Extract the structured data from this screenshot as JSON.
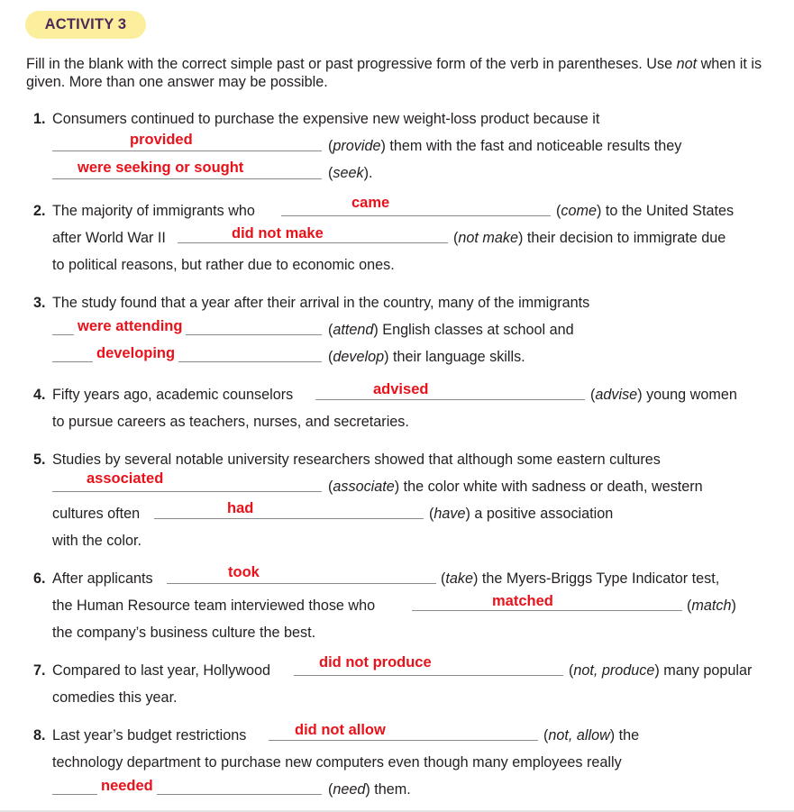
{
  "header": {
    "badge": "ACTIVITY 3"
  },
  "instructions": {
    "part1": "Fill in the blank with the correct simple past or past progressive form of the verb in parentheses. Use ",
    "not_word": "not",
    "part2": " when it is given. More than one answer may be possible."
  },
  "items": {
    "i1": {
      "num": "1.",
      "t1": "Consumers continued to purchase the expensive new weight-loss product because it",
      "v1": "provide",
      "t2": " them with the fast and noticeable results they",
      "v2": "seek",
      "t3": ".",
      "a1": "provided",
      "a2": "were seeking or sought"
    },
    "i2": {
      "num": "2.",
      "t1": "The majority of immigrants who",
      "v1": "come",
      "t2": " to the United States",
      "t3": "after World War II",
      "v2": "not make",
      "t4": " their decision to immigrate due",
      "t5": "to political reasons, but rather due to economic ones.",
      "a1": "came",
      "a2": "did not make"
    },
    "i3": {
      "num": "3.",
      "t1": "The study found that a year after their arrival in the country, many of the immigrants",
      "v1": "attend",
      "t2": " English classes at school and",
      "v2": "develop",
      "t3": " their language skills.",
      "a1": "were attending",
      "a2": "developing"
    },
    "i4": {
      "num": "4.",
      "t1": "Fifty years ago, academic counselors",
      "v1": "advise",
      "t2": " young women",
      "t3": "to pursue careers as teachers, nurses, and secretaries.",
      "a1": "advised"
    },
    "i5": {
      "num": "5.",
      "t1": "Studies by several notable university researchers showed that although some eastern cultures",
      "v1": "associate",
      "t2": " the color white with sadness or death, western",
      "t3": "cultures often",
      "v2": "have",
      "t4": " a positive association",
      "t5": "with the color.",
      "a1": "associated",
      "a2": "had"
    },
    "i6": {
      "num": "6.",
      "t1": "After applicants",
      "v1": "take",
      "t2": " the Myers-Briggs Type Indicator test,",
      "t3": "the Human Resource team interviewed those who",
      "v2": "match",
      "t4": "the company’s business culture the best.",
      "a1": "took",
      "a2": "matched"
    },
    "i7": {
      "num": "7.",
      "t1": "Compared to last year, Hollywood",
      "v1": "not, produce",
      "t2": " many popular",
      "t3": "comedies this year.",
      "a1": "did not produce"
    },
    "i8": {
      "num": "8.",
      "t1": "Last year’s budget restrictions",
      "v1": "not, allow",
      "t2": " the",
      "t3": "technology department to purchase new computers even though many employees really",
      "v2": "need",
      "t4": " them.",
      "a1": "did not allow",
      "a2": "needed"
    }
  }
}
